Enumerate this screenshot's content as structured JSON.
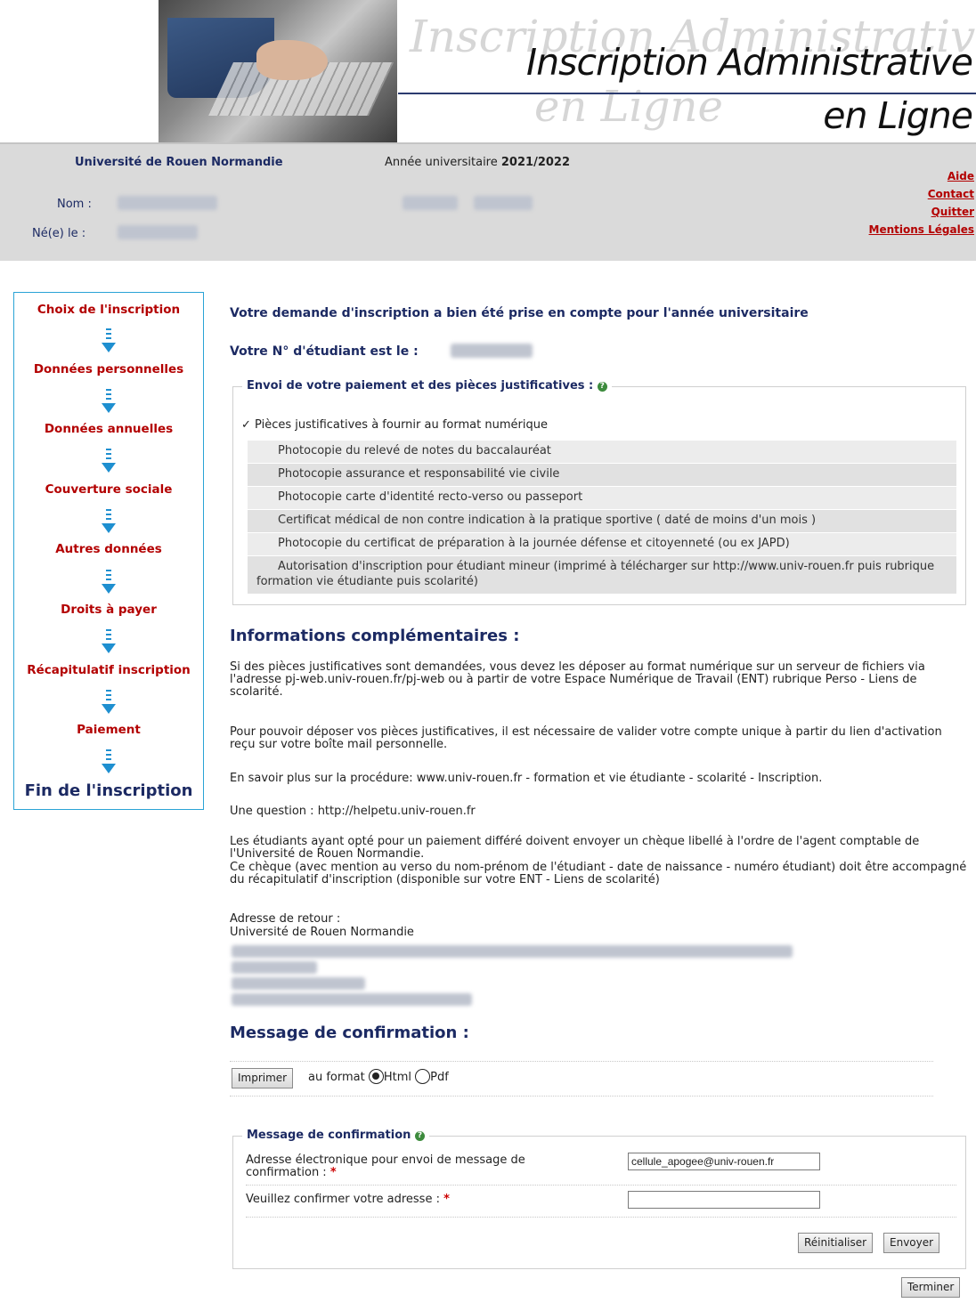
{
  "header": {
    "title_line1": "Inscription Administrative",
    "title_line2": "en Ligne",
    "watermark_line1": "Inscription Administrative",
    "watermark_line2": "en Ligne"
  },
  "infobar": {
    "university": "Université de Rouen Normandie",
    "year_label": "Année universitaire ",
    "year_value": "2021/2022",
    "nom_label": "Nom :",
    "ne_le_label": "Né(e) le :",
    "links": [
      "Aide",
      "Contact",
      "Quitter",
      "Mentions Légales"
    ]
  },
  "steps": [
    "Choix de l'inscription",
    "Données personnelles",
    "Données annuelles",
    "Couverture sociale",
    "Autres données",
    "Droits à payer",
    "Récapitulatif inscription",
    "Paiement",
    "Fin de l'inscription"
  ],
  "main": {
    "confirmation_heading": "Votre demande d'inscription a bien été prise en compte pour l'année universitaire",
    "student_number_label": "Votre N° d'étudiant est le :",
    "pieces_legend": "Envoi de votre paiement et des pièces justificatives :",
    "pieces_title": "Pièces justificatives à fournir au format numérique",
    "pieces_check": "✓",
    "pieces": [
      "Photocopie du relevé de notes du baccalauréat",
      "Photocopie assurance et responsabilité vie civile",
      "Photocopie carte d'identité recto-verso ou passeport",
      "Certificat médical de non contre indication à la pratique sportive ( daté de moins d'un mois )",
      "Photocopie du certificat de préparation à la journée défense et citoyenneté (ou ex JAPD)",
      "Autorisation d'inscription pour étudiant mineur (imprimé à télécharger sur http://www.univ-rouen.fr puis rubrique formation vie étudiante puis scolarité)"
    ],
    "info_title": "Informations complémentaires :",
    "info_p1": "Si des pièces justificatives sont demandées, vous devez les déposer au format numérique sur un serveur de fichiers via l'adresse pj-web.univ-rouen.fr/pj-web ou à partir de votre Espace Numérique de Travail (ENT) rubrique Perso - Liens de scolarité.",
    "info_p2": "Pour pouvoir déposer vos pièces justificatives, il est nécessaire de valider votre compte unique à partir du lien d'activation reçu sur votre boîte mail personnelle.",
    "info_p3": "En savoir plus sur la procédure: www.univ-rouen.fr - formation et vie étudiante - scolarité - Inscription.",
    "info_p4": "Une question : http://helpetu.univ-rouen.fr",
    "info_p5a": "Les étudiants ayant opté pour un paiement différé doivent envoyer un chèque libellé à l'ordre de l'agent comptable de l'Université de Rouen Normandie.",
    "info_p5b": "Ce chèque (avec mention au verso du nom-prénom de l'étudiant - date de naissance - numéro étudiant) doit être accompagné du récapitulatif d'inscription (disponible sur votre ENT - Liens de scolarité)",
    "return_label": "Adresse de retour :",
    "return_univ": "Université de Rouen Normandie",
    "message_title": "Message de confirmation :",
    "print_button": "Imprimer",
    "format_label": "au format",
    "format_html": "Html",
    "format_pdf": "Pdf",
    "format_selected": "Html",
    "mc_legend": "Message de confirmation",
    "email_label": "Adresse électronique pour envoi de message de confirmation :",
    "email_value": "cellule_apogee@univ-rouen.fr",
    "confirm_label": "Veuillez confirmer votre adresse :",
    "confirm_value": "",
    "required_mark": "*",
    "reset_button": "Réinitialiser",
    "send_button": "Envoyer",
    "finish_button": "Terminer"
  },
  "colors": {
    "accent_red": "#b30000",
    "navy": "#1c2a63",
    "step_border": "#2aa3d6",
    "arrow_blue": "#1e8fd0",
    "infobar_bg": "#dadada"
  },
  "icons": {
    "help": "help-circle-icon",
    "arrow": "arrow-down-icon",
    "check": "checkmark-icon"
  }
}
